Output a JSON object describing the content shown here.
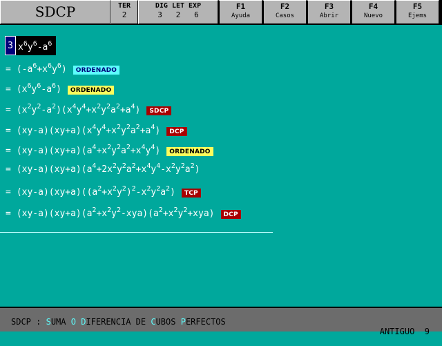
{
  "toolbar": {
    "app_title": "SDCP",
    "ter": {
      "label": "TER",
      "value": "2"
    },
    "dig": {
      "label": "DIG LET EXP",
      "value": "3   2   6"
    },
    "fkeys": [
      {
        "key": "F1",
        "label": "Ayuda"
      },
      {
        "key": "F2",
        "label": "Casos"
      },
      {
        "key": "F3",
        "label": "Abrir"
      },
      {
        "key": "F4",
        "label": "Nuevo"
      },
      {
        "key": "F5",
        "label": "Ejems"
      }
    ]
  },
  "input": {
    "number": "3",
    "expression": [
      "x",
      "6",
      "y",
      "6",
      "-a",
      "6"
    ]
  },
  "steps": [
    {
      "eq": "=",
      "badge": "ORDENADO",
      "badge_color": "#5dfcfc"
    },
    {
      "eq": "=",
      "badge": "ORDENADO",
      "badge_color": "#fcfc5c"
    },
    {
      "eq": "=",
      "badge": "SDCP",
      "badge_color": "#a80000"
    },
    {
      "eq": "=",
      "badge": "DCP",
      "badge_color": "#a80000"
    },
    {
      "eq": "=",
      "badge": "ORDENADO",
      "badge_color": "#fcfc5c"
    },
    {
      "eq": "=",
      "badge": "",
      "badge_color": ""
    },
    {
      "eq": "=",
      "badge": "TCP",
      "badge_color": "#a80000"
    },
    {
      "eq": "=",
      "badge": "DCP",
      "badge_color": "#a80000"
    }
  ],
  "step_texts": [
    [
      "(-a",
      "6",
      "+x",
      "6",
      "y",
      "6",
      ")"
    ],
    [
      "(x",
      "6",
      "y",
      "6",
      "-a",
      "6",
      ")"
    ],
    [
      "(x",
      "2",
      "y",
      "2",
      "-a",
      "2",
      ")(x",
      "4",
      "y",
      "4",
      "+x",
      "2",
      "y",
      "2",
      "a",
      "2",
      "+a",
      "4",
      ")"
    ],
    [
      "(xy-a)(xy+a)(x",
      "4",
      "y",
      "4",
      "+x",
      "2",
      "y",
      "2",
      "a",
      "2",
      "+a",
      "4",
      ")"
    ],
    [
      "(xy-a)(xy+a)(a",
      "4",
      "+x",
      "2",
      "y",
      "2",
      "a",
      "2",
      "+x",
      "4",
      "y",
      "4",
      ")"
    ],
    [
      "(xy-a)(xy+a)(a",
      "4",
      "+2x",
      "2",
      "y",
      "2",
      "a",
      "2",
      "+x",
      "4",
      "y",
      "4",
      "-x",
      "2",
      "y",
      "2",
      "a",
      "2",
      ")"
    ],
    [
      "(xy-a)(xy+a)((a",
      "2",
      "+x",
      "2",
      "y",
      "2",
      ")",
      "2",
      "-x",
      "2",
      "y",
      "2",
      "a",
      "2",
      ")"
    ],
    [
      "(xy-a)(xy+a)(a",
      "2",
      "+x",
      "2",
      "y",
      "2",
      "-xya)(a",
      "2",
      "+x",
      "2",
      "y",
      "2",
      "+xya)"
    ]
  ],
  "status": {
    "legend_parts": [
      "SDCP : ",
      "S",
      "UMA ",
      "O",
      " ",
      "D",
      "IFERENCIA DE ",
      "C",
      "UBOS ",
      "P",
      "ERFECTOS"
    ],
    "mode": "ANTIGUO",
    "count": "9"
  },
  "colors": {
    "background": "#00a89c",
    "toolbar": "#b4b4b4",
    "statusbar": "#6c6c6c",
    "highlight": "#5dfcfc"
  }
}
